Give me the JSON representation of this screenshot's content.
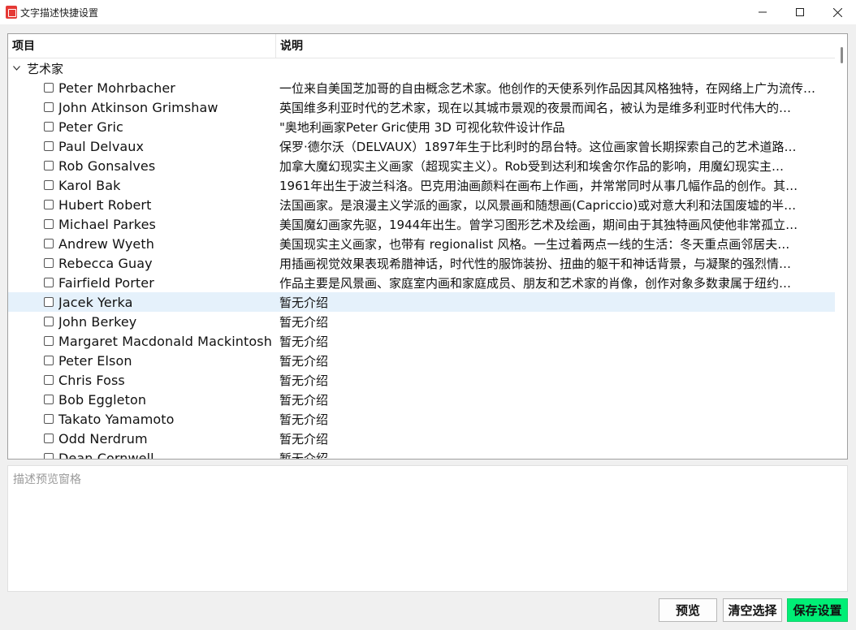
{
  "window": {
    "title": "文字描述快捷设置",
    "controls": {
      "minimize": "—",
      "maximize": "☐",
      "close": "✕"
    }
  },
  "tree": {
    "columns": [
      "项目",
      "说明"
    ],
    "group": "艺术家",
    "rows": [
      {
        "name": "Peter Mohrbacher",
        "desc": "一位来自美国芝加哥的自由概念艺术家。他创作的天使系列作品因其风格独特，在网络上广为流传…",
        "selected": false
      },
      {
        "name": "John Atkinson Grimshaw",
        "desc": "英国维多利亚时代的艺术家，现在以其城市景观的夜景而闻名，被认为是维多利亚时代伟大的…",
        "selected": false
      },
      {
        "name": "Peter Gric",
        "desc": "\"奥地利画家Peter Gric使用 3D 可视化软件设计作品",
        "selected": false
      },
      {
        "name": "Paul Delvaux",
        "desc": "保罗·德尔沃（DELVAUX）1897年生于比利时的昂台特。这位画家曾长期探索自己的艺术道路…",
        "selected": false
      },
      {
        "name": "Rob Gonsalves",
        "desc": "加拿大魔幻现实主义画家（超现实主义）。Rob受到达利和埃舍尔作品的影响，用魔幻现实主…",
        "selected": false
      },
      {
        "name": "Karol Bak",
        "desc": "1961年出生于波兰科洛。巴克用油画颜料在画布上作画，并常常同时从事几幅作品的创作。其…",
        "selected": false
      },
      {
        "name": "Hubert Robert",
        "desc": "法国画家。是浪漫主义学派的画家，以风景画和随想画(Capriccio)或对意大利和法国废墟的半…",
        "selected": false
      },
      {
        "name": "Michael Parkes",
        "desc": "美国魔幻画家先驱，1944年出生。曾学习图形艺术及绘画，期间由于其独特画风使他非常孤立…",
        "selected": false
      },
      {
        "name": "Andrew Wyeth",
        "desc": "美国现实主义画家，也带有 regionalist 风格。一生过着两点一线的生活：冬天重点画邻居夫…",
        "selected": false
      },
      {
        "name": "Rebecca Guay",
        "desc": "用插画视觉效果表现希腊神话，时代性的服饰装扮、扭曲的躯干和神话背景，与凝聚的强烈情…",
        "selected": false
      },
      {
        "name": "Fairfield Porter",
        "desc": "作品主要是风景画、家庭室内画和家庭成员、朋友和艺术家的肖像，创作对象多数隶属于纽约…",
        "selected": false
      },
      {
        "name": "Jacek Yerka",
        "desc": "暂无介绍",
        "selected": true
      },
      {
        "name": "John Berkey",
        "desc": "暂无介绍",
        "selected": false
      },
      {
        "name": "Margaret Macdonald Mackintosh",
        "desc": "暂无介绍",
        "selected": false
      },
      {
        "name": "Peter Elson",
        "desc": "暂无介绍",
        "selected": false
      },
      {
        "name": "Chris Foss",
        "desc": "暂无介绍",
        "selected": false
      },
      {
        "name": "Bob Eggleton",
        "desc": "暂无介绍",
        "selected": false
      },
      {
        "name": "Takato Yamamoto",
        "desc": "暂无介绍",
        "selected": false
      },
      {
        "name": "Odd Nerdrum",
        "desc": "暂无介绍",
        "selected": false
      },
      {
        "name": "Dean Cornwell",
        "desc": "暂无介绍",
        "selected": false
      }
    ]
  },
  "preview": {
    "placeholder": "描述预览窗格"
  },
  "buttons": {
    "preview": "预览",
    "clear": "清空选择",
    "save": "保存设置"
  },
  "colors": {
    "save_bg": "#00ee76",
    "selected_row": "#e5f1fb",
    "app_icon": "#e53935"
  }
}
